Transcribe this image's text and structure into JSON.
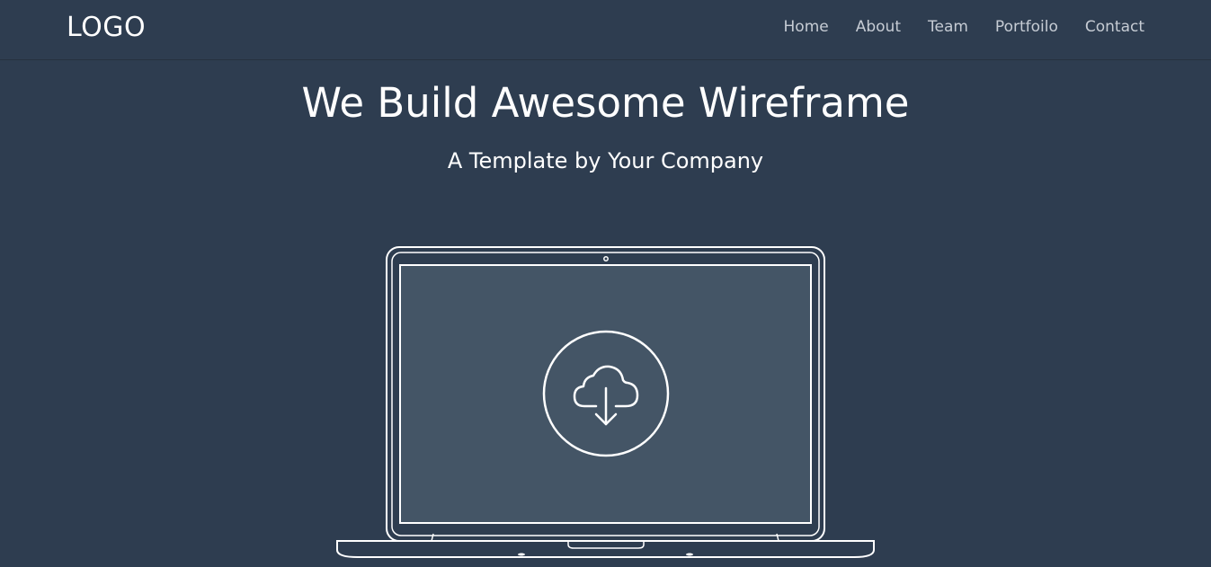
{
  "header": {
    "logo": "LOGO",
    "nav": [
      "Home",
      "About",
      "Team",
      "Portfoilo",
      "Contact"
    ]
  },
  "hero": {
    "title": "We Build Awesome Wireframe",
    "subtitle": "A Template by Your Company"
  },
  "illustration": {
    "device": "laptop",
    "screen_icon": "cloud-download-icon"
  },
  "colors": {
    "background": "#2e3d50",
    "screen": "#445566",
    "line": "#ffffff",
    "nav_text": "#c6ccd4"
  }
}
